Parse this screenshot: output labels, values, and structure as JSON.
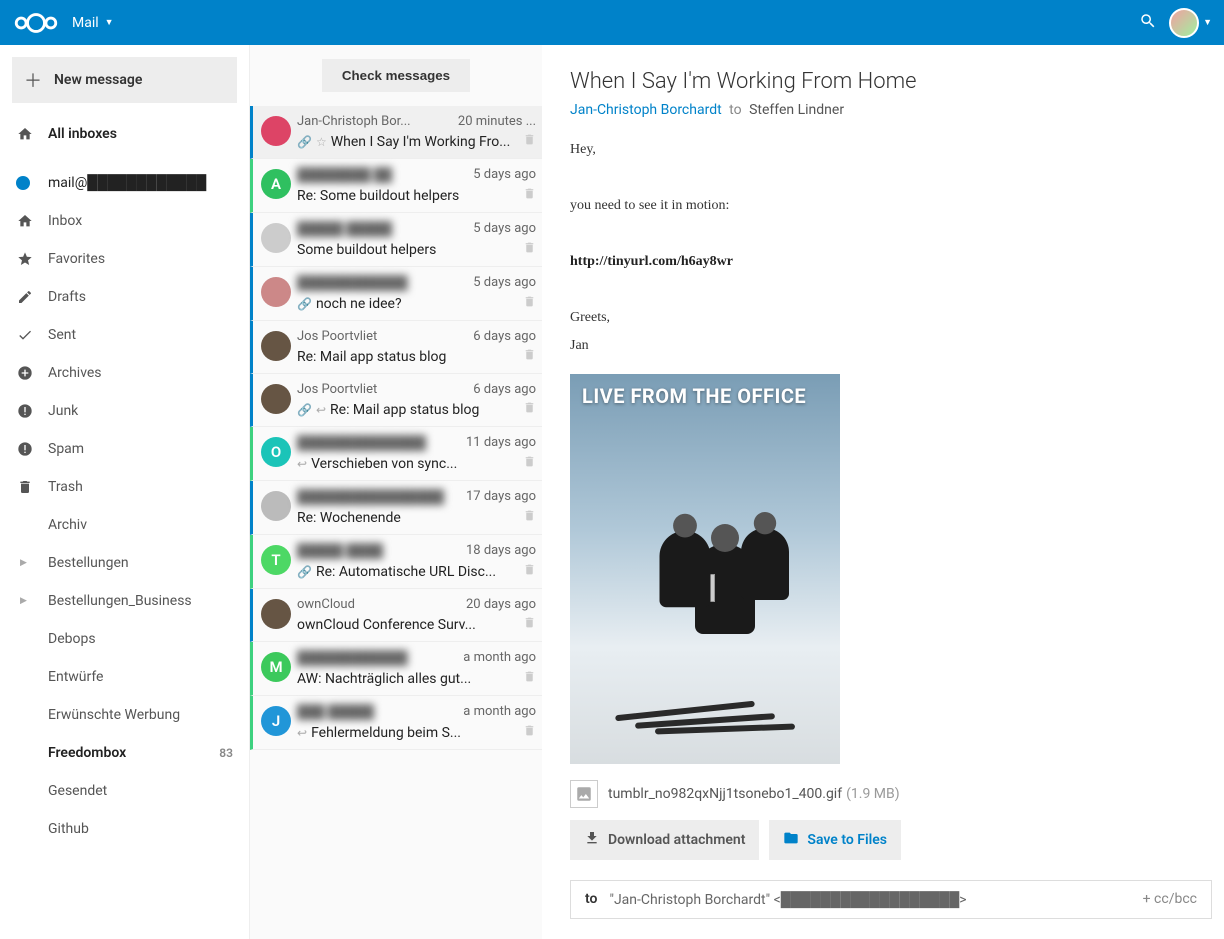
{
  "header": {
    "app_name": "Mail"
  },
  "sidebar": {
    "new_message": "New message",
    "all_inboxes": "All inboxes",
    "account_email": "mail@████████████",
    "folders": [
      {
        "label": "Inbox",
        "icon": "home"
      },
      {
        "label": "Favorites",
        "icon": "star"
      },
      {
        "label": "Drafts",
        "icon": "pencil"
      },
      {
        "label": "Sent",
        "icon": "check"
      },
      {
        "label": "Archives",
        "icon": "dashboard"
      },
      {
        "label": "Junk",
        "icon": "bang"
      },
      {
        "label": "Spam",
        "icon": "bang"
      },
      {
        "label": "Trash",
        "icon": "trash"
      }
    ],
    "custom": [
      {
        "label": "Archiv",
        "indent": "sub"
      },
      {
        "label": "Bestellungen",
        "indent": "arrow"
      },
      {
        "label": "Bestellungen_Business",
        "indent": "arrow"
      },
      {
        "label": "Debops",
        "indent": "sub"
      },
      {
        "label": "Entwürfe",
        "indent": "sub"
      },
      {
        "label": "Erwünschte Werbung",
        "indent": "sub"
      },
      {
        "label": "Freedombox",
        "indent": "sub",
        "bold": true,
        "badge": "83"
      },
      {
        "label": "Gesendet",
        "indent": "sub"
      },
      {
        "label": "Github",
        "indent": "sub"
      }
    ]
  },
  "msglist": {
    "check": "Check messages",
    "items": [
      {
        "sender": "Jan-Christoph Bor...",
        "time": "20 minutes ...",
        "subject": "When I Say I'm Working Fro...",
        "stripe": "blue",
        "selected": true,
        "clip": true,
        "star": true,
        "avatar": "img",
        "avcolor": "#d46"
      },
      {
        "sender": "████████ ██",
        "time": "5 days ago",
        "subject": "Re: Some buildout helpers",
        "stripe": "green",
        "avatar": "A",
        "avcolor": "#2fc060",
        "blur": true
      },
      {
        "sender": "█████ █████",
        "time": "5 days ago",
        "subject": "Some buildout helpers",
        "stripe": "blue",
        "avatar": "img",
        "avcolor": "#ccc",
        "blur": true
      },
      {
        "sender": "████████████",
        "time": "5 days ago",
        "subject": "noch ne idee?",
        "stripe": "blue",
        "clip": true,
        "avatar": "img",
        "avcolor": "#c88",
        "blur": true
      },
      {
        "sender": "Jos Poortvliet",
        "time": "6 days ago",
        "subject": "Re: Mail app status blog",
        "stripe": "blue",
        "avatar": "img",
        "avcolor": "#654"
      },
      {
        "sender": "Jos Poortvliet",
        "time": "6 days ago",
        "subject": "Re: Mail app status blog",
        "stripe": "blue",
        "clip": true,
        "reply": true,
        "avatar": "img",
        "avcolor": "#654"
      },
      {
        "sender": "██████████████",
        "time": "11 days ago",
        "subject": "Verschieben von sync...",
        "stripe": "green",
        "reply": true,
        "avatar": "O",
        "avcolor": "#1bc4b8",
        "blur": true
      },
      {
        "sender": "████████████████",
        "time": "17 days ago",
        "subject": "Re: Wochenende",
        "stripe": "blue",
        "avatar": "img",
        "avcolor": "#bbb",
        "blur": true
      },
      {
        "sender": "█████ ████",
        "time": "18 days ago",
        "subject": "Re: Automatische URL Disc...",
        "stripe": "green",
        "clip": true,
        "avatar": "T",
        "avcolor": "#4dd865",
        "blur": true
      },
      {
        "sender": "ownCloud",
        "time": "20 days ago",
        "subject": "ownCloud Conference Surv...",
        "stripe": "blue",
        "avatar": "img",
        "avcolor": "#654"
      },
      {
        "sender": "████████████",
        "time": "a month ago",
        "subject": "AW: Nachträglich alles gut...",
        "stripe": "green",
        "avatar": "M",
        "avcolor": "#3cc95c",
        "blur": true
      },
      {
        "sender": "███ █████",
        "time": "a month ago",
        "subject": "Fehlermeldung beim S...",
        "stripe": "green",
        "reply": true,
        "avatar": "J",
        "avcolor": "#2196d8",
        "blur": true
      }
    ]
  },
  "content": {
    "subject": "When I Say I'm Working From Home",
    "from": "Jan-Christoph Borchardt",
    "to_word": "to",
    "to": "Steffen Lindner",
    "body_line1": "Hey,",
    "body_line2": "you need to see it in motion:",
    "body_link": "http://tinyurl.com/h6ay8wr",
    "body_line3": "Greets,",
    "body_line4": "Jan",
    "img_overlay": "LIVE FROM THE OFFICE",
    "attach_name": "tumblr_no982qxNjj1tsonebo1_400.gif",
    "attach_size": "(1.9 MB)",
    "download_label": "Download attachment",
    "save_label": "Save to Files",
    "reply_to_label": "to",
    "reply_addr": "\"Jan-Christoph Borchardt\" <██████████████████>",
    "ccbcc": "+ cc/bcc"
  }
}
